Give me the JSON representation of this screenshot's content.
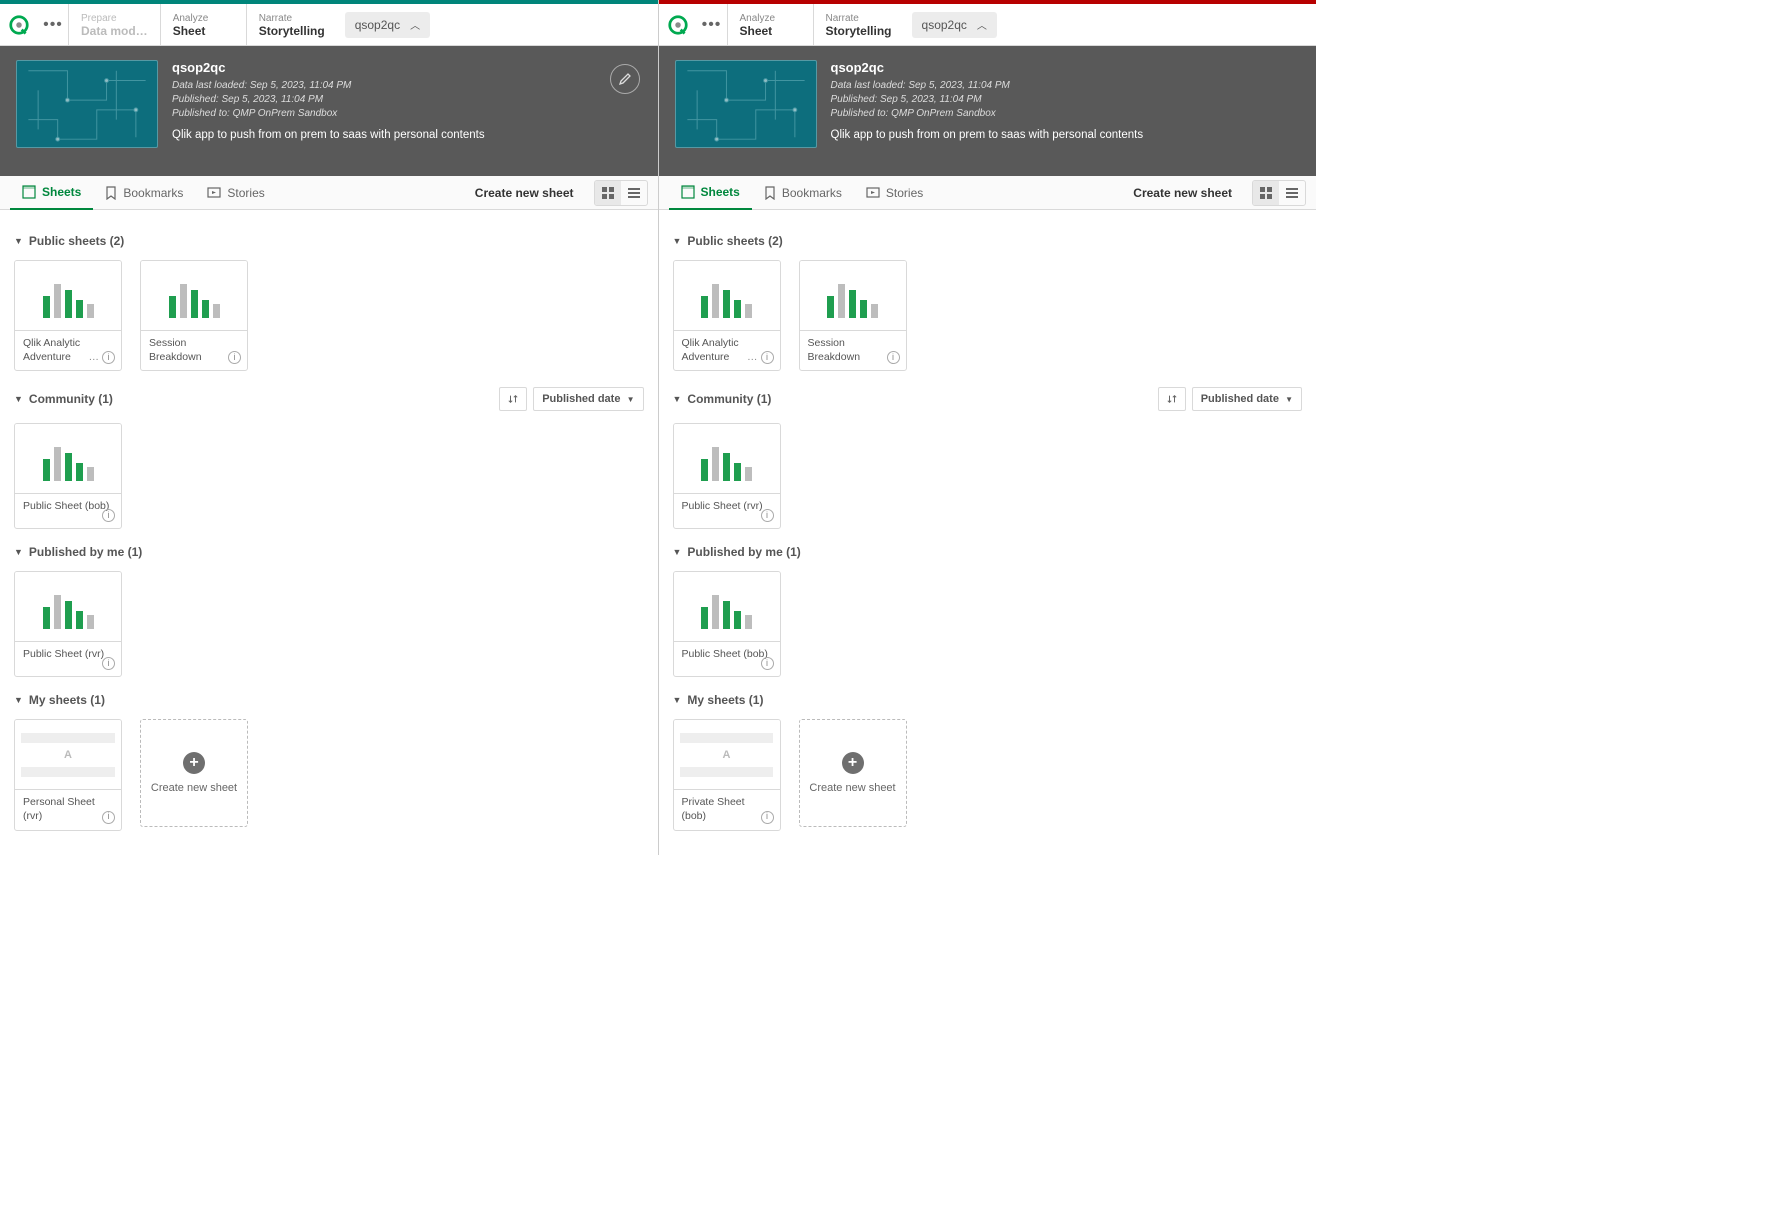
{
  "left": {
    "nav": {
      "prepare": {
        "sup": "Prepare",
        "sub": "Data mod…",
        "off": true
      },
      "analyze": {
        "sup": "Analyze",
        "sub": "Sheet"
      },
      "narrate": {
        "sup": "Narrate",
        "sub": "Storytelling"
      },
      "appname": "qsop2qc"
    },
    "hero": {
      "title": "qsop2qc",
      "loaded": "Data last loaded: Sep 5, 2023, 11:04 PM",
      "published": "Published: Sep 5, 2023, 11:04 PM",
      "publishedTo": "Published to: QMP OnPrem Sandbox",
      "desc": "Qlik app to push from on prem to saas with personal contents"
    },
    "tabs": {
      "sheets": "Sheets",
      "bookmarks": "Bookmarks",
      "stories": "Stories",
      "create": "Create new sheet"
    },
    "sections": {
      "public": {
        "title": "Public sheets (2)",
        "cards": [
          {
            "name": "Qlik Analytic Adventure",
            "dots": true
          },
          {
            "name": "Session Breakdown"
          }
        ]
      },
      "community": {
        "title": "Community (1)",
        "sort": "Published date",
        "cards": [
          {
            "name": "Public Sheet (bob)"
          }
        ]
      },
      "pubme": {
        "title": "Published by me (1)",
        "cards": [
          {
            "name": "Public Sheet (rvr)"
          }
        ]
      },
      "my": {
        "title": "My sheets (1)",
        "cards": [
          {
            "name": "Personal Sheet (rvr)",
            "blank": true
          }
        ],
        "new": "Create new sheet"
      }
    }
  },
  "right": {
    "nav": {
      "analyze": {
        "sup": "Analyze",
        "sub": "Sheet"
      },
      "narrate": {
        "sup": "Narrate",
        "sub": "Storytelling"
      },
      "appname": "qsop2qc"
    },
    "hero": {
      "title": "qsop2qc",
      "loaded": "Data last loaded: Sep 5, 2023, 11:04 PM",
      "published": "Published: Sep 5, 2023, 11:04 PM",
      "publishedTo": "Published to: QMP OnPrem Sandbox",
      "desc": "Qlik app to push from on prem to saas with personal contents"
    },
    "tabs": {
      "sheets": "Sheets",
      "bookmarks": "Bookmarks",
      "stories": "Stories",
      "create": "Create new sheet"
    },
    "sections": {
      "public": {
        "title": "Public sheets (2)",
        "cards": [
          {
            "name": "Qlik Analytic Adventure",
            "dots": true
          },
          {
            "name": "Session Breakdown"
          }
        ]
      },
      "community": {
        "title": "Community (1)",
        "sort": "Published date",
        "cards": [
          {
            "name": "Public Sheet (rvr)"
          }
        ]
      },
      "pubme": {
        "title": "Published by me (1)",
        "cards": [
          {
            "name": "Public Sheet (bob)"
          }
        ]
      },
      "my": {
        "title": "My sheets (1)",
        "cards": [
          {
            "name": "Private Sheet (bob)",
            "blank": true
          }
        ],
        "new": "Create new sheet"
      }
    }
  }
}
